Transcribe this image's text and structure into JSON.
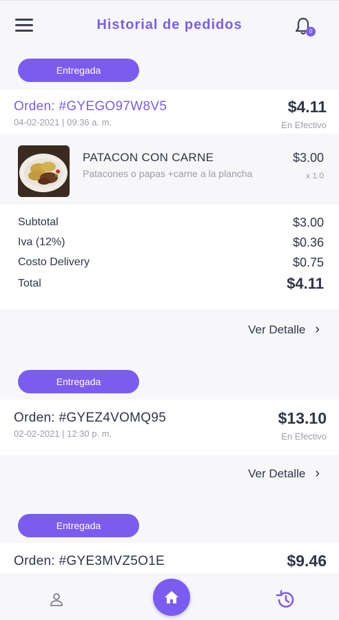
{
  "header": {
    "title": "Historial de pedidos",
    "notification_count": "0"
  },
  "orders": [
    {
      "status": "Entregada",
      "id": "Orden: #GYEGO97W8V5",
      "date": "04-02-2021 | 09:36 a. m.",
      "total": "$4.11",
      "payment": "En Efectivo",
      "items": [
        {
          "name": "PATACON CON CARNE",
          "description": "Patacones o papas +carne a la plancha",
          "price": "$3.00",
          "quantity": "x 1.0"
        }
      ],
      "summary": {
        "subtotal_label": "Subtotal",
        "subtotal": "$3.00",
        "iva_label": "Iva (12%)",
        "iva": "$0.36",
        "delivery_label": "Costo Delivery",
        "delivery": "$0.75",
        "total_label": "Total",
        "total": "$4.11"
      },
      "detail_link": "Ver Detalle"
    },
    {
      "status": "Entregada",
      "id": "Orden: #GYEZ4VOMQ95",
      "date": "02-02-2021 | 12:30 p. m.",
      "total": "$13.10",
      "payment": "En Efectivo",
      "detail_link": "Ver Detalle"
    },
    {
      "status": "Entregada",
      "id": "Orden: #GYE3MVZ5O1E",
      "total": "$9.46"
    }
  ],
  "colors": {
    "accent": "#7b5cf0",
    "text": "#2f3547",
    "muted": "#9a9caa",
    "background": "#f7f7f9"
  },
  "nav": {
    "items": [
      "user-icon",
      "home-icon",
      "history-icon"
    ]
  }
}
